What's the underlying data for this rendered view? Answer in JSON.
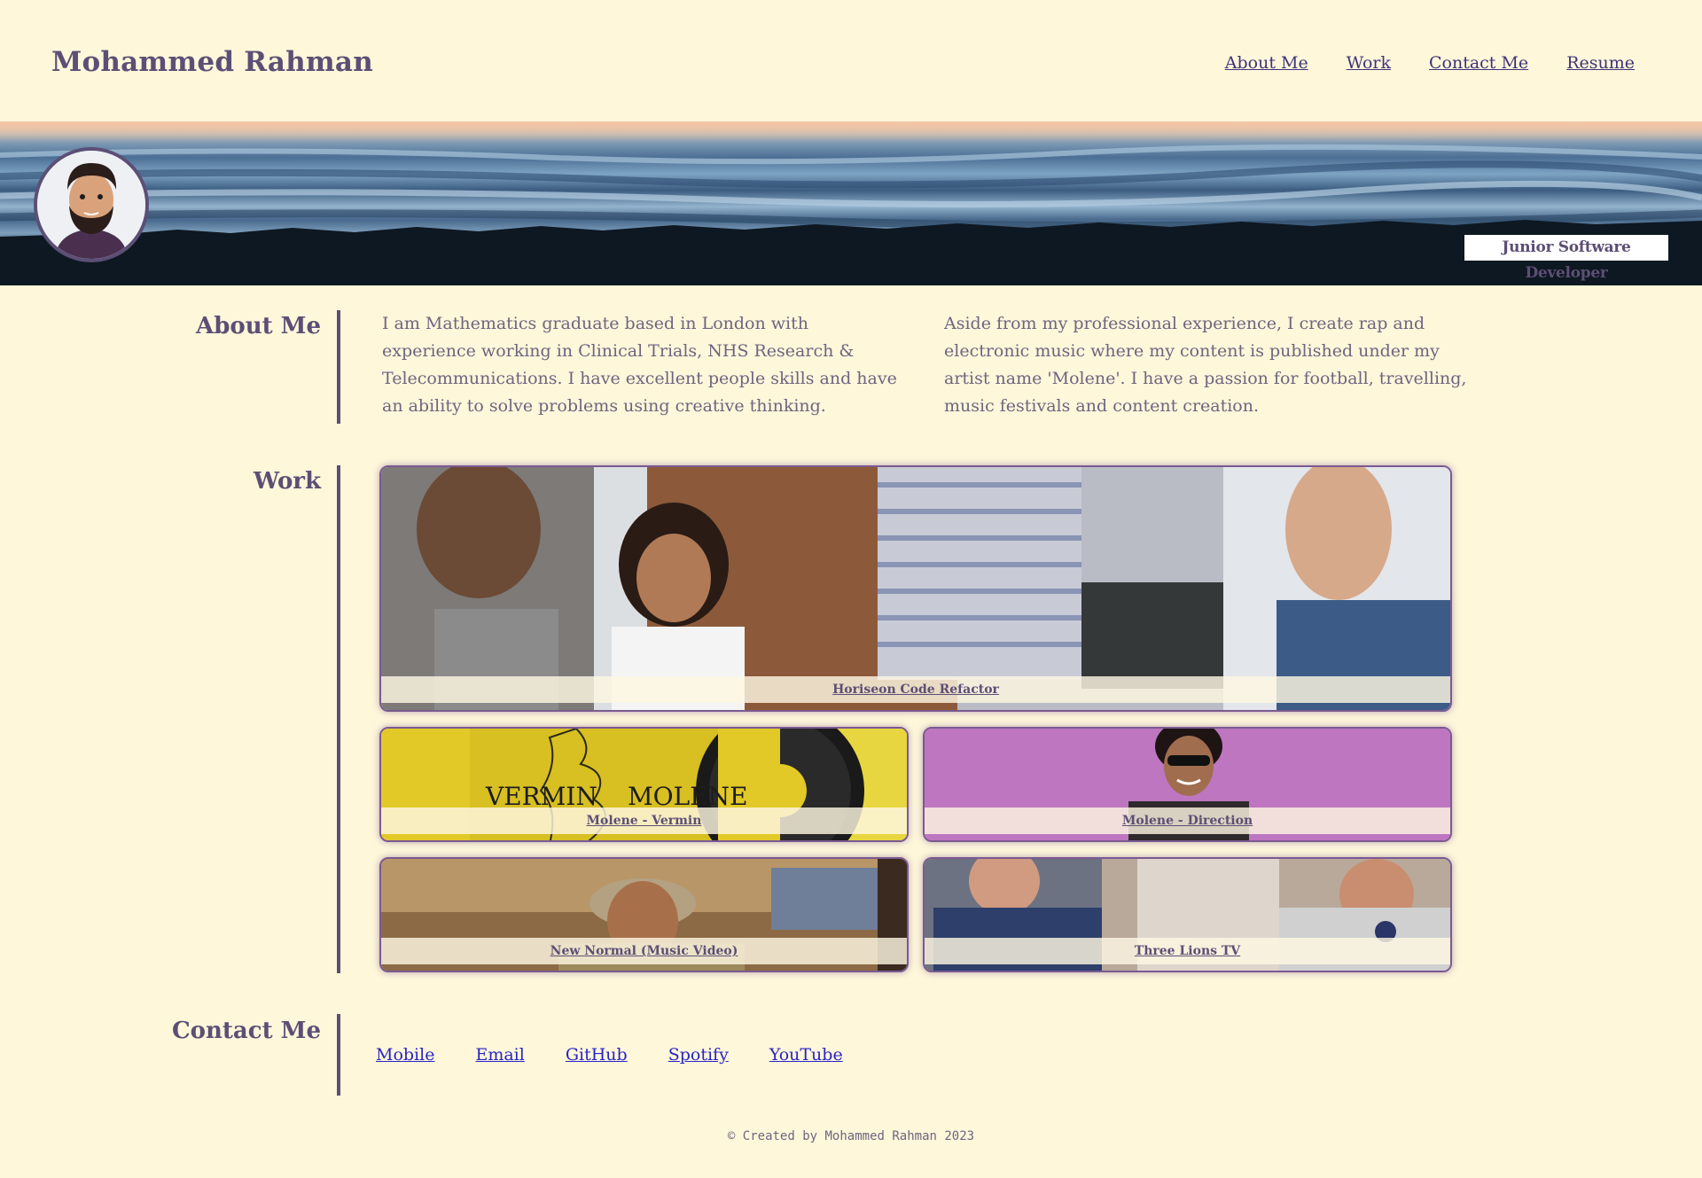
{
  "header": {
    "site_title": "Mohammed Rahman",
    "nav": [
      "About Me",
      "Work",
      "Contact Me",
      "Resume"
    ]
  },
  "hero": {
    "avatar_icon": "avatar-icon",
    "job_title": "Junior Software Developer"
  },
  "about": {
    "heading": "About Me",
    "paragraph_1": "I am Mathematics graduate based in London with experience working in Clinical Trials, NHS Research & Telecommunications. I have excellent people skills and have an ability to solve problems using creative thinking.",
    "paragraph_2": "Aside from my professional experience, I create rap and electronic music where my content is published under my artist name 'Molene'. I have a passion for football, travelling, music festivals and content creation."
  },
  "work": {
    "heading": "Work",
    "projects": [
      {
        "title": "Horiseon Code Refactor"
      },
      {
        "title": "Molene - Vermin"
      },
      {
        "title": "Molene - Direction"
      },
      {
        "title": "New Normal (Music Video)"
      },
      {
        "title": "Three Lions TV"
      }
    ],
    "vermin_art_left": "VERMIN",
    "vermin_art_right": "MOLENE"
  },
  "contact": {
    "heading": "Contact Me",
    "links": [
      "Mobile",
      "Email",
      "GitHub",
      "Spotify",
      "YouTube"
    ]
  },
  "footer": {
    "text": "© Created by Mohammed Rahman 2023"
  },
  "colors": {
    "background": "#fef7da",
    "primary": "#5c4f75",
    "nav_link": "#3f3379",
    "contact_link": "#2a24c6"
  }
}
